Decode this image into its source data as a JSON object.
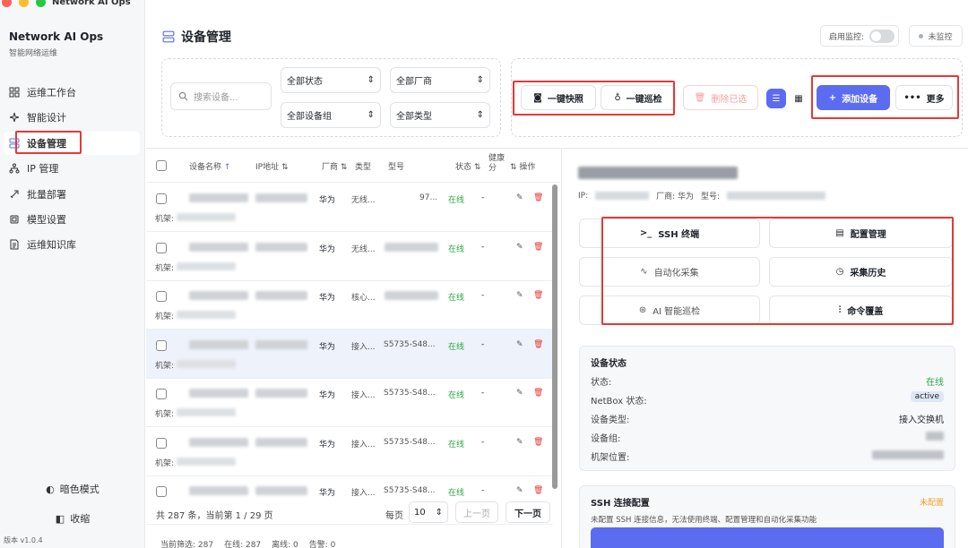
{
  "window": {
    "title": "Network AI Ops"
  },
  "brand": {
    "name": "Network AI Ops",
    "subtitle": "智能网络运维"
  },
  "sidebar": {
    "items": [
      {
        "label": "运维工作台",
        "icon": "dashboard-icon"
      },
      {
        "label": "智能设计",
        "icon": "sparkle-icon"
      },
      {
        "label": "设备管理",
        "icon": "server-icon",
        "active": true
      },
      {
        "label": "IP 管理",
        "icon": "network-icon"
      },
      {
        "label": "批量部署",
        "icon": "rocket-icon"
      },
      {
        "label": "模型设置",
        "icon": "chip-icon"
      },
      {
        "label": "运维知识库",
        "icon": "document-icon"
      }
    ],
    "dark_mode_label": "暗色模式",
    "collapse_label": "收缩",
    "version": "版本 v1.0.4"
  },
  "header": {
    "title": "设备管理",
    "monitor_label": "启用监控:",
    "monitor_status": "未监控"
  },
  "filters": {
    "search_placeholder": "搜索设备...",
    "status": "全部状态",
    "vendor": "全部厂商",
    "group": "全部设备组",
    "type": "全部类型"
  },
  "actions": {
    "snapshot": "一键快照",
    "inspect": "一键巡检",
    "delete_selected": "删除已选",
    "add_device": "添加设备",
    "more": "更多"
  },
  "table": {
    "columns": [
      "设备名称",
      "IP地址",
      "厂商",
      "类型",
      "型号",
      "状态",
      "健康分",
      "操作"
    ],
    "rows": [
      {
        "vendor": "华为",
        "type": "无线...",
        "model": "97...",
        "status": "在线",
        "health": "-",
        "rack": "机架:"
      },
      {
        "vendor": "华为",
        "type": "无线...",
        "model": "",
        "status": "在线",
        "health": "-",
        "rack": "机架:"
      },
      {
        "vendor": "华为",
        "type": "核心...",
        "model": "",
        "status": "在线",
        "health": "-",
        "rack": "机架:"
      },
      {
        "vendor": "华为",
        "type": "接入...",
        "model": "S5735-S48...",
        "status": "在线",
        "health": "-",
        "rack": "机架:",
        "selected": true
      },
      {
        "vendor": "华为",
        "type": "接入...",
        "model": "S5735-S48...",
        "status": "在线",
        "health": "-",
        "rack": "机架:"
      },
      {
        "vendor": "华为",
        "type": "接入...",
        "model": "S5735-S48...",
        "status": "在线",
        "health": "-",
        "rack": "机架:"
      },
      {
        "vendor": "华为",
        "type": "接入...",
        "model": "S5735-S48...",
        "status": "在线",
        "health": "-",
        "rack": ""
      }
    ]
  },
  "pagination": {
    "summary": "共 287 条，当前第 1 / 29 页",
    "per_page_label": "每页",
    "per_page": "10",
    "prev": "上一页",
    "next": "下一页"
  },
  "footer": {
    "filtered": "当前筛选: 287",
    "online": "在线: 287",
    "offline": "离线: 0",
    "alarm": "告警: 0"
  },
  "detail": {
    "ip_label": "IP:",
    "vendor_label": "厂商: 华为",
    "model_label": "型号:",
    "buttons": {
      "ssh": "SSH 终端",
      "config": "配置管理",
      "auto_collect": "自动化采集",
      "history": "采集历史",
      "ai_inspect": "AI 智能巡检",
      "cmd_override": "命令覆盖"
    },
    "status_card": {
      "title": "设备状态",
      "state_label": "状态:",
      "state_value": "在线",
      "netbox_label": "NetBox 状态:",
      "netbox_value": "active",
      "type_label": "设备类型:",
      "type_value": "接入交换机",
      "group_label": "设备组:",
      "rack_label": "机架位置:"
    },
    "ssh_card": {
      "title": "SSH 连接配置",
      "badge": "未配置",
      "desc": "未配置 SSH 连接信息，无法使用终端、配置管理和自动化采集功能"
    }
  },
  "colors": {
    "accent": "#5b6cf0",
    "online": "#29a745",
    "danger": "#e53935",
    "warn": "#f0a020"
  }
}
